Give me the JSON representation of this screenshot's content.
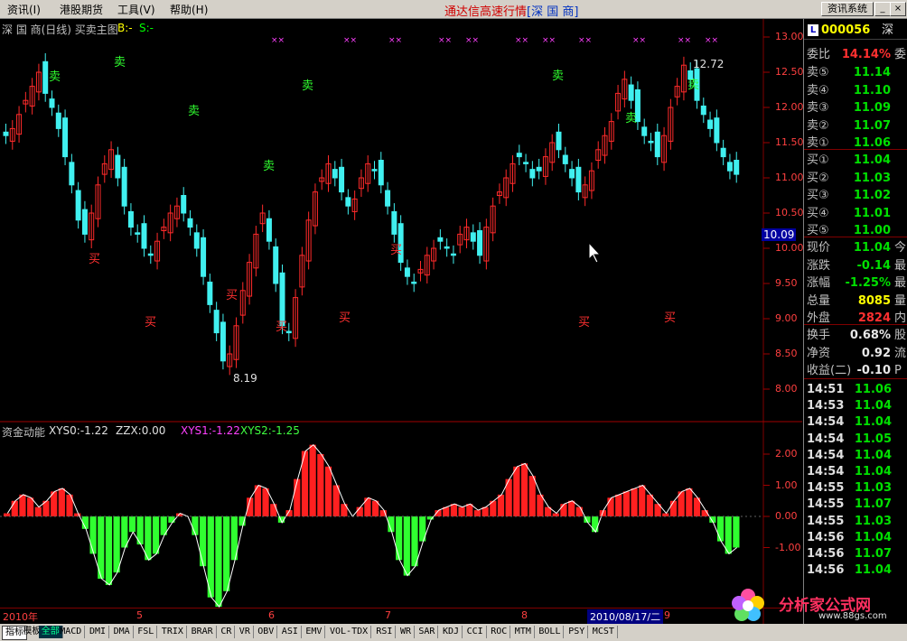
{
  "menu": {
    "items": [
      "资讯(I)",
      "港股期货",
      "工具(V)",
      "帮助(H)"
    ],
    "title_prefix": "通达信高速行情",
    "title_stock": "[深 国 商]",
    "news_button": "资讯系统"
  },
  "chart_labels": {
    "main": "深 国 商(日线)  买卖主图",
    "b_label": "B:-",
    "s_label": "S:-",
    "indicator_name": "资金动能",
    "xys0": "XYS0:-1.22",
    "zzx": "ZZX:0.00",
    "xys1": "XYS1:-1.22",
    "xys2": "XYS2:-1.25",
    "high_marker": "12.72",
    "low_marker": "8.19",
    "price_tag": "10.09"
  },
  "price_axis": [
    "13.00",
    "12.50",
    "12.00",
    "11.50",
    "11.00",
    "10.50",
    "10.00",
    "9.50",
    "9.00",
    "8.50",
    "8.00"
  ],
  "indicator_axis": [
    "2.00",
    "1.00",
    "0.00",
    "-1.00"
  ],
  "date_axis": [
    "2010年",
    "5",
    "6",
    "7",
    "8",
    "9"
  ],
  "date_highlight": "2010/08/17/二",
  "quote": {
    "code": "000056",
    "market": "深",
    "l_badge": "L",
    "weibi_label": "委比",
    "weibi_value": "14.14%",
    "weibi_tail": "委",
    "sells": [
      {
        "label": "卖⑤",
        "price": "11.14"
      },
      {
        "label": "卖④",
        "price": "11.10"
      },
      {
        "label": "卖③",
        "price": "11.09"
      },
      {
        "label": "卖②",
        "price": "11.07"
      },
      {
        "label": "卖①",
        "price": "11.06"
      }
    ],
    "buys": [
      {
        "label": "买①",
        "price": "11.04"
      },
      {
        "label": "买②",
        "price": "11.03"
      },
      {
        "label": "买③",
        "price": "11.02"
      },
      {
        "label": "买④",
        "price": "11.01"
      },
      {
        "label": "买⑤",
        "price": "11.00"
      }
    ],
    "stats": [
      {
        "label": "现价",
        "value": "11.04",
        "tail": "今",
        "color": "green"
      },
      {
        "label": "涨跌",
        "value": "-0.14",
        "tail": "最",
        "color": "green"
      },
      {
        "label": "涨幅",
        "value": "-1.25%",
        "tail": "最",
        "color": "green"
      },
      {
        "label": "总量",
        "value": "8085",
        "tail": "量",
        "color": "yellow"
      },
      {
        "label": "外盘",
        "value": "2824",
        "tail": "内",
        "color": "red"
      },
      {
        "label": "换手",
        "value": "0.68%",
        "tail": "股",
        "color": "white"
      },
      {
        "label": "净资",
        "value": "0.92",
        "tail": "流",
        "color": "white"
      },
      {
        "label": "收益(二)",
        "value": "-0.10",
        "tail": "P",
        "color": "white"
      }
    ],
    "ticks": [
      {
        "time": "14:51",
        "price": "11.06"
      },
      {
        "time": "14:53",
        "price": "11.04"
      },
      {
        "time": "14:54",
        "price": "11.04"
      },
      {
        "time": "14:54",
        "price": "11.05"
      },
      {
        "time": "14:54",
        "price": "11.04"
      },
      {
        "time": "14:54",
        "price": "11.04"
      },
      {
        "time": "14:55",
        "price": "11.03"
      },
      {
        "time": "14:55",
        "price": "11.07"
      },
      {
        "time": "14:55",
        "price": "11.03"
      },
      {
        "time": "14:56",
        "price": "11.04"
      },
      {
        "time": "14:56",
        "price": "11.07"
      },
      {
        "time": "14:56",
        "price": "11.04"
      }
    ]
  },
  "tabs": [
    "指标",
    "模板",
    "全部",
    "MACD",
    "DMI",
    "DMA",
    "FSL",
    "TRIX",
    "BRAR",
    "CR",
    "VR",
    "OBV",
    "ASI",
    "EMV",
    "VOL-TDX",
    "RSI",
    "WR",
    "SAR",
    "KDJ",
    "CCI",
    "ROC",
    "MTM",
    "BOLL",
    "PSY",
    "MCST"
  ],
  "logo": {
    "text": "分析家公式网",
    "url": "www.88gs.com"
  },
  "signals": {
    "sell": "卖",
    "buy": "买"
  },
  "colors": {
    "up": "#ff2a2a",
    "down": "#40f0f0",
    "ind_pos": "#ff2020",
    "ind_neg": "#30ff30",
    "accent": "#ffff00"
  }
}
